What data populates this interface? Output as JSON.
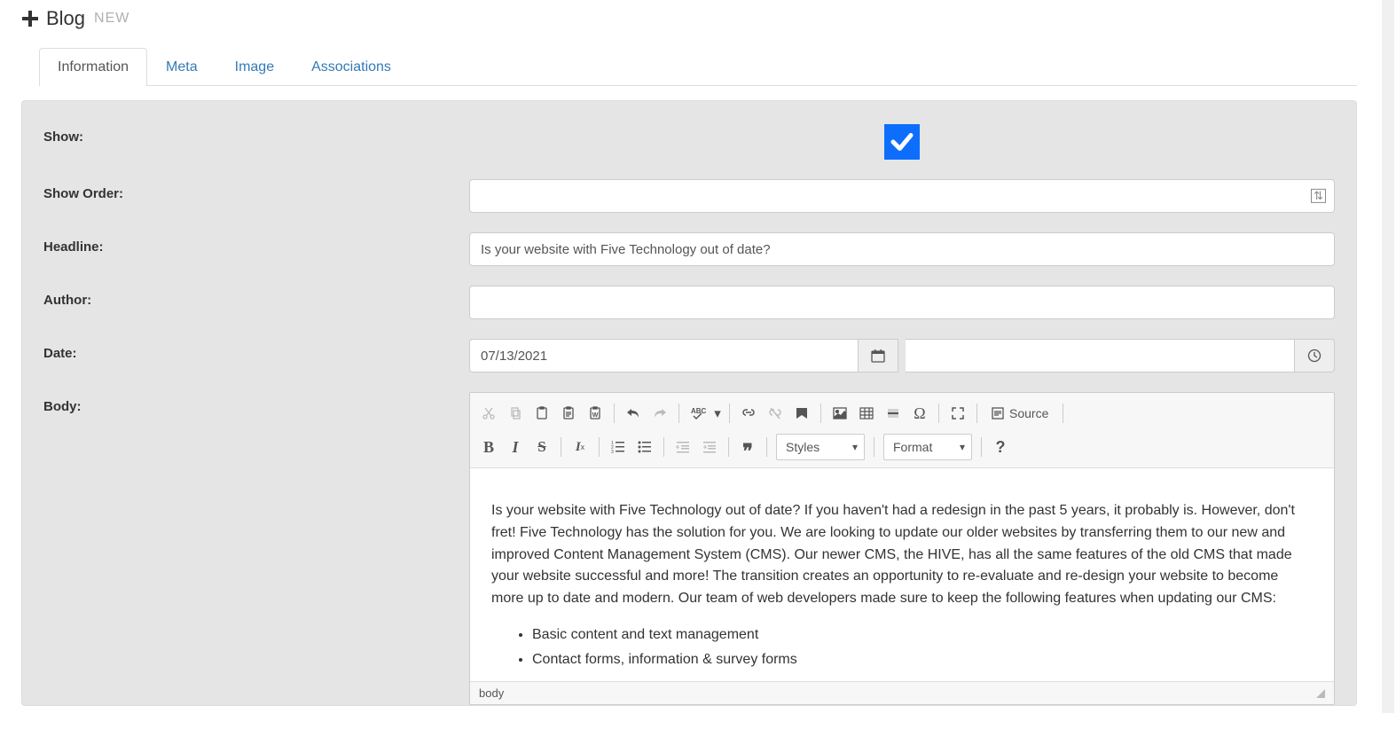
{
  "header": {
    "title": "Blog",
    "badge": "NEW"
  },
  "tabs": [
    {
      "label": "Information",
      "active": true
    },
    {
      "label": "Meta",
      "active": false
    },
    {
      "label": "Image",
      "active": false
    },
    {
      "label": "Associations",
      "active": false
    }
  ],
  "form": {
    "show": {
      "label": "Show:",
      "checked": true
    },
    "show_order": {
      "label": "Show Order:",
      "value": ""
    },
    "headline": {
      "label": "Headline:",
      "value": "Is your website with Five Technology out of date?"
    },
    "author": {
      "label": "Author:",
      "value": ""
    },
    "date": {
      "label": "Date:",
      "value": "07/13/2021",
      "time_value": ""
    },
    "body": {
      "label": "Body:"
    }
  },
  "editor": {
    "toolbar": {
      "source_label": "Source",
      "styles_label": "Styles",
      "format_label": "Format"
    },
    "paragraph": "Is your website with Five Technology out of date? If you haven't had a redesign in the past 5 years, it probably is. However, don't fret! Five Technology has the solution for you. We are looking to update our older websites by transferring them to our new and improved Content Management System (CMS). Our newer CMS, the HIVE, has all the same features of the old CMS that made your website successful and more! The transition creates an opportunity to re-evaluate and re-design your website to become more up to date and modern. Our team of web developers made sure to keep the following features when updating our CMS:",
    "bullets": [
      "Basic content and text management",
      "Contact forms, information & survey forms"
    ],
    "path": "body"
  }
}
